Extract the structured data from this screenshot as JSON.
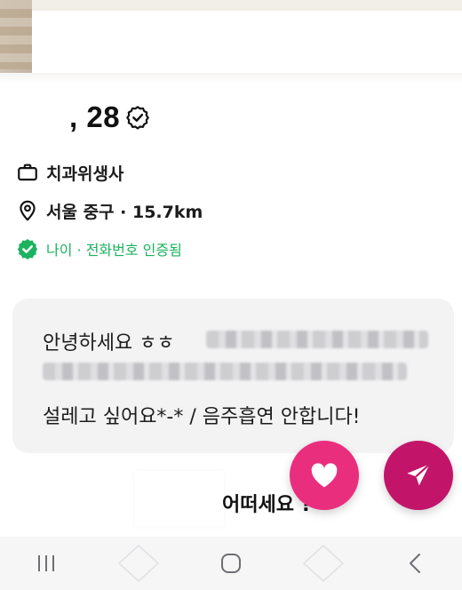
{
  "profile": {
    "age_text": ", 28",
    "job": "치과위생사",
    "location": "서울 중구 · 15.7km",
    "verification": "나이 · 전화번호 인증됨"
  },
  "bio": {
    "line1": "안녕하세요 ㅎㅎ",
    "line3": "설레고 싶어요*-* / 음주흡연 안합니다!"
  },
  "question": {
    "text": "어떠세요 ?"
  },
  "colors": {
    "like": "#ea2e7e",
    "send": "#c2156a",
    "verified": "#1bb35e",
    "card": "#f3f3f4"
  },
  "icons": {
    "verified_badge": "badge-check-icon",
    "job": "briefcase-icon",
    "location": "location-pin-icon",
    "verified": "check-badge-icon",
    "like": "heart-icon",
    "send": "paper-plane-icon",
    "nav_recent": "recent-apps-icon",
    "nav_home": "home-icon",
    "nav_back": "back-icon"
  }
}
